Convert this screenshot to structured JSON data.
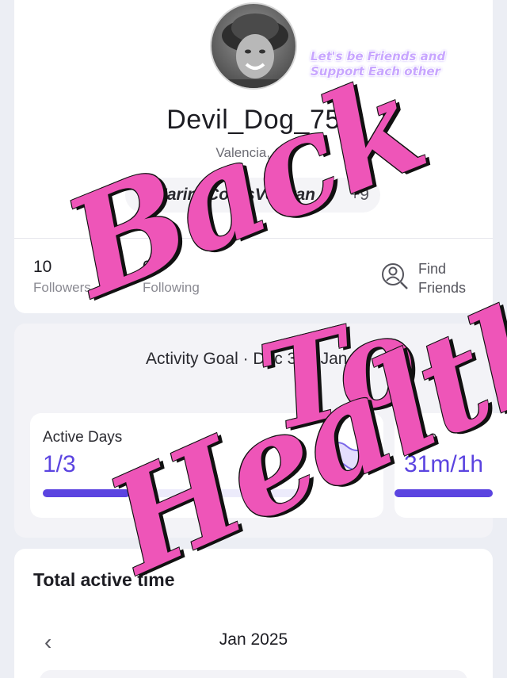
{
  "profile": {
    "username": "Devil_Dog_75",
    "location": "Valencia, Ca",
    "note": "Let's be Friends and Support Each other",
    "tag": "MarineCorpsVeteran",
    "tag_more": "+9"
  },
  "stats": {
    "followers_count": "10",
    "followers_label": "Followers",
    "following_count": "0",
    "following_label": "Following",
    "find_label": "Find Friends"
  },
  "activity_goal": {
    "title": "Activity Goal · Dec 30 - Jan 5",
    "active_days": {
      "label": "Active Days",
      "value": "1/3",
      "progress_fraction": 0.333
    },
    "time": {
      "label": "Time",
      "value": "31m/1h",
      "progress_fraction": 0.52
    }
  },
  "total_active_time": {
    "title": "Total active time",
    "month": "Jan 2025",
    "prev_icon": "chevron-left-icon"
  },
  "overlay_text": {
    "line1": "Back",
    "line2": "To",
    "line3": "Health"
  },
  "colors": {
    "accent": "#5b44e0",
    "overlay_pink": "#ee55b8",
    "hashtag_blue": "#3a7ad8"
  }
}
